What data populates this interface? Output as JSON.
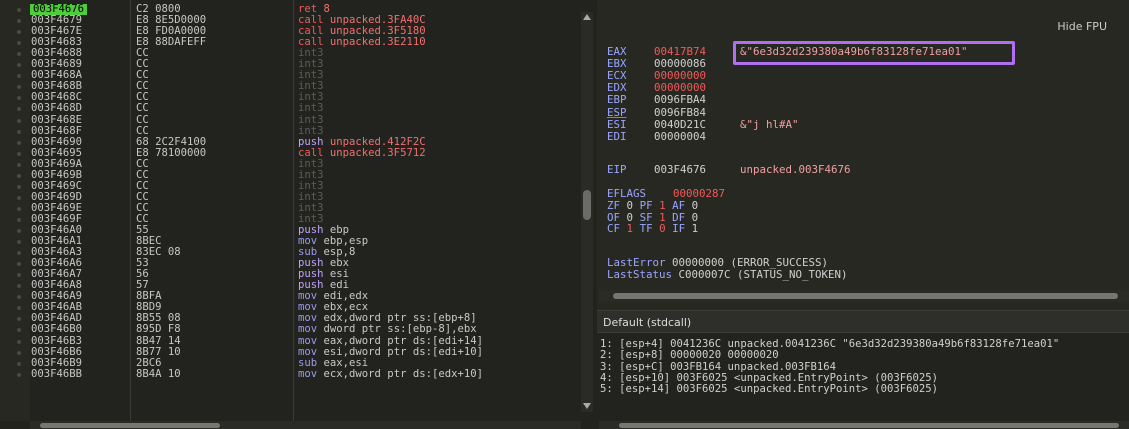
{
  "disasm": {
    "rows": [
      {
        "addr": "003F4676",
        "bytes": "C2 0800",
        "mn": "ret",
        "ops": "8",
        "mc": "kw-ret",
        "current": true
      },
      {
        "addr": "003F4679",
        "bytes": "E8 8E5D0000",
        "mn": "call",
        "ops": "unpacked.3FA40C",
        "mc": "kw-call"
      },
      {
        "addr": "003F467E",
        "bytes": "E8 FD0A0000",
        "mn": "call",
        "ops": "unpacked.3F5180",
        "mc": "kw-call"
      },
      {
        "addr": "003F4683",
        "bytes": "E8 88DAFEFF",
        "mn": "call",
        "ops": "unpacked.3E2110",
        "mc": "kw-call"
      },
      {
        "addr": "003F4688",
        "bytes": "CC",
        "mn": "int3",
        "ops": "",
        "mc": "kw-int"
      },
      {
        "addr": "003F4689",
        "bytes": "CC",
        "mn": "int3",
        "ops": "",
        "mc": "kw-int"
      },
      {
        "addr": "003F468A",
        "bytes": "CC",
        "mn": "int3",
        "ops": "",
        "mc": "kw-int"
      },
      {
        "addr": "003F468B",
        "bytes": "CC",
        "mn": "int3",
        "ops": "",
        "mc": "kw-int"
      },
      {
        "addr": "003F468C",
        "bytes": "CC",
        "mn": "int3",
        "ops": "",
        "mc": "kw-int"
      },
      {
        "addr": "003F468D",
        "bytes": "CC",
        "mn": "int3",
        "ops": "",
        "mc": "kw-int"
      },
      {
        "addr": "003F468E",
        "bytes": "CC",
        "mn": "int3",
        "ops": "",
        "mc": "kw-int"
      },
      {
        "addr": "003F468F",
        "bytes": "CC",
        "mn": "int3",
        "ops": "",
        "mc": "kw-int"
      },
      {
        "addr": "003F4690",
        "bytes": "68 2C2F4100",
        "mn": "push",
        "ops": "unpacked.412F2C",
        "mc": "kw-push"
      },
      {
        "addr": "003F4695",
        "bytes": "E8 78100000",
        "mn": "call",
        "ops": "unpacked.3F5712",
        "mc": "kw-call"
      },
      {
        "addr": "003F469A",
        "bytes": "CC",
        "mn": "int3",
        "ops": "",
        "mc": "kw-int"
      },
      {
        "addr": "003F469B",
        "bytes": "CC",
        "mn": "int3",
        "ops": "",
        "mc": "kw-int"
      },
      {
        "addr": "003F469C",
        "bytes": "CC",
        "mn": "int3",
        "ops": "",
        "mc": "kw-int"
      },
      {
        "addr": "003F469D",
        "bytes": "CC",
        "mn": "int3",
        "ops": "",
        "mc": "kw-int"
      },
      {
        "addr": "003F469E",
        "bytes": "CC",
        "mn": "int3",
        "ops": "",
        "mc": "kw-int"
      },
      {
        "addr": "003F469F",
        "bytes": "CC",
        "mn": "int3",
        "ops": "",
        "mc": "kw-int"
      },
      {
        "addr": "003F46A0",
        "bytes": "55",
        "mn": "push",
        "ops": "ebp",
        "mc": "kw-push"
      },
      {
        "addr": "003F46A1",
        "bytes": "8BEC",
        "mn": "mov",
        "ops": "ebp,esp",
        "mc": "kw-mov"
      },
      {
        "addr": "003F46A3",
        "bytes": "83EC 08",
        "mn": "sub",
        "ops": "esp,8",
        "mc": "kw-sub"
      },
      {
        "addr": "003F46A6",
        "bytes": "53",
        "mn": "push",
        "ops": "ebx",
        "mc": "kw-push"
      },
      {
        "addr": "003F46A7",
        "bytes": "56",
        "mn": "push",
        "ops": "esi",
        "mc": "kw-push"
      },
      {
        "addr": "003F46A8",
        "bytes": "57",
        "mn": "push",
        "ops": "edi",
        "mc": "kw-push"
      },
      {
        "addr": "003F46A9",
        "bytes": "8BFA",
        "mn": "mov",
        "ops": "edi,edx",
        "mc": "kw-mov"
      },
      {
        "addr": "003F46AB",
        "bytes": "8BD9",
        "mn": "mov",
        "ops": "ebx,ecx",
        "mc": "kw-mov"
      },
      {
        "addr": "003F46AD",
        "bytes": "8B55 08",
        "mn": "mov",
        "ops": "edx,dword ptr  ss:[ebp+8]",
        "mc": "kw-mov"
      },
      {
        "addr": "003F46B0",
        "bytes": "895D F8",
        "mn": "mov",
        "ops": "dword ptr  ss:[ebp-8],ebx",
        "mc": "kw-mov"
      },
      {
        "addr": "003F46B3",
        "bytes": "8B47 14",
        "mn": "mov",
        "ops": "eax,dword ptr  ds:[edi+14]",
        "mc": "kw-mov"
      },
      {
        "addr": "003F46B6",
        "bytes": "8B77 10",
        "mn": "mov",
        "ops": "esi,dword ptr  ds:[edi+10]",
        "mc": "kw-mov"
      },
      {
        "addr": "003F46B9",
        "bytes": "2BC6",
        "mn": "sub",
        "ops": "eax,esi",
        "mc": "kw-sub"
      },
      {
        "addr": "003F46BB",
        "bytes": "8B4A 10",
        "mn": "mov",
        "ops": "ecx,dword ptr  ds:[edx+10]",
        "mc": "kw-mov"
      }
    ]
  },
  "registers": {
    "hide_fpu": "Hide FPU",
    "list": [
      {
        "name": "EAX",
        "value": "00417B74",
        "red": true,
        "comment": "&\"6e3d32d239380a49b6f83128fe71ea01\""
      },
      {
        "name": "EBX",
        "value": "00000086",
        "red": false,
        "comment": ""
      },
      {
        "name": "ECX",
        "value": "00000000",
        "red": true,
        "comment": ""
      },
      {
        "name": "EDX",
        "value": "00000000",
        "red": true,
        "comment": ""
      },
      {
        "name": "EBP",
        "value": "0096FBA4",
        "red": false,
        "comment": ""
      },
      {
        "name": "ESP",
        "value": "0096FB84",
        "red": false,
        "comment": ""
      },
      {
        "name": "ESI",
        "value": "0040D21C",
        "red": false,
        "comment": "&\"j hl#A\""
      },
      {
        "name": "EDI",
        "value": "00000004",
        "red": false,
        "comment": ""
      }
    ],
    "eip": {
      "name": "EIP",
      "value": "003F4676",
      "comment": "unpacked.003F4676"
    },
    "eflags_label": "EFLAGS",
    "eflags_value": "00000287",
    "flags_row1": [
      {
        "n": "ZF",
        "v": "0"
      },
      {
        "n": "PF",
        "v": "1",
        "red": true
      },
      {
        "n": "AF",
        "v": "0"
      }
    ],
    "flags_row2": [
      {
        "n": "OF",
        "v": "0"
      },
      {
        "n": "SF",
        "v": "1",
        "red": true
      },
      {
        "n": "DF",
        "v": "0"
      }
    ],
    "flags_row3": [
      {
        "n": "CF",
        "v": "1",
        "red": true
      },
      {
        "n": "TF",
        "v": "0",
        "red": true
      },
      {
        "n": "IF",
        "v": "1"
      }
    ],
    "last_error_label": "LastError",
    "last_error_value": "00000000 (ERROR_SUCCESS)",
    "last_status_label": "LastStatus",
    "last_status_value": "C000007C (STATUS_NO_TOKEN)"
  },
  "stack": {
    "title": "Default (stdcall)",
    "lines": [
      "1: [esp+4] 0041236C unpacked.0041236C \"6e3d32d239380a49b6f83128fe71ea01\"",
      "2: [esp+8] 00000020 00000020",
      "3: [esp+C] 003FB164 unpacked.003FB164",
      "4: [esp+10] 003F6025 <unpacked.EntryPoint> (003F6025)",
      "5: [esp+14] 003F6025 <unpacked.EntryPoint> (003F6025)"
    ]
  }
}
